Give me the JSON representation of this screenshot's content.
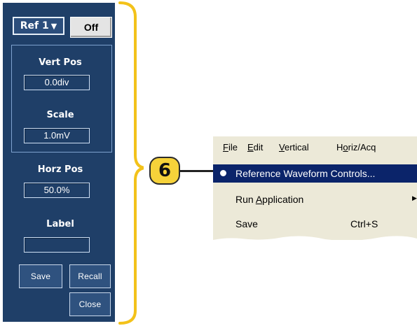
{
  "panel": {
    "ref_select": {
      "label": "Ref 1",
      "arrow": "▼"
    },
    "off_button": "Off",
    "vert_pos": {
      "label": "Vert Pos",
      "value": "0.0div"
    },
    "scale": {
      "label": "Scale",
      "value": "1.0mV"
    },
    "horz_pos": {
      "label": "Horz Pos",
      "value": "50.0%"
    },
    "label_field": {
      "label": "Label",
      "value": ""
    },
    "save_button": "Save",
    "recall_button": "Recall",
    "close_button": "Close",
    "colors": {
      "panel_bg": "#1f3f68",
      "bracket": "#f3c21a"
    }
  },
  "callout": {
    "number": "6",
    "color": "#f6d23a"
  },
  "menu": {
    "menubar": [
      {
        "mnemonic": "F",
        "rest": "ile"
      },
      {
        "mnemonic": "E",
        "rest": "dit"
      },
      {
        "mnemonic": "V",
        "rest": "ertical"
      },
      {
        "pre": "H",
        "mnemonic": "o",
        "rest": "riz/Acq"
      }
    ],
    "items": {
      "reference_waveform": "Reference Waveform Controls...",
      "run_application_pre": "Run ",
      "run_application_mnemonic": "A",
      "run_application_rest": "pplication",
      "submenu_arrow": "▶",
      "save_partial": "Save",
      "save_shortcut": "Ctrl+S"
    },
    "colors": {
      "highlight": "#0b246a",
      "menu_bg": "#ece9d8"
    }
  }
}
